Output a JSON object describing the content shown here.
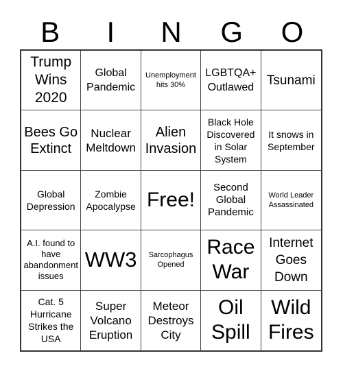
{
  "title_letters": [
    "B",
    "I",
    "N",
    "G",
    "O"
  ],
  "cells": [
    "Trump Wins 2020",
    "Global Pandemic",
    "Unemployment hits 30%",
    "LGBTQA+ Outlawed",
    "Tsunami",
    "Bees Go Extinct",
    "Nuclear Meltdown",
    "Alien Invasion",
    "Black Hole Discovered in Solar System",
    "It snows in September",
    "Global Depression",
    "Zombie Apocalypse",
    "Free!",
    "Second Global Pandemic",
    "World Leader Assassinated",
    "A.I. found to have abandonment issues",
    "WW3",
    "Sarcophagus Opened",
    "Race War",
    "Internet Goes Down",
    "Cat. 5 Hurricane Strikes the USA",
    "Super Volcano Eruption",
    "Meteor Destroys City",
    "Oil Spill",
    "Wild Fires"
  ],
  "free_space": "Free!",
  "colors": {
    "grid_line": "#333333",
    "text": "#000000",
    "background": "#ffffff"
  }
}
